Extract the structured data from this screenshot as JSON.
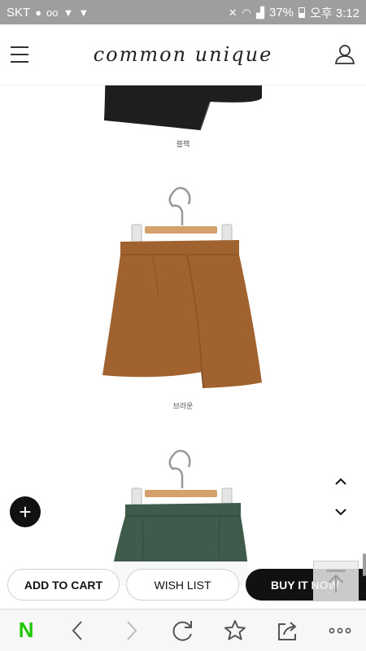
{
  "status_bar": {
    "carrier": "SKT",
    "battery": "37%",
    "time": "오후 3:12"
  },
  "header": {
    "logo": "common unique",
    "menu_icon": "hamburger-menu-icon",
    "account_icon": "user-icon"
  },
  "products": [
    {
      "caption": "블랙",
      "color": "#1e1e1e"
    },
    {
      "caption": "브라운",
      "color": "#a0622f"
    },
    {
      "caption": "",
      "color": "#3f5b4b"
    }
  ],
  "floating": {
    "add_icon": "plus-icon",
    "scroll_up_icon": "chevron-up-icon",
    "scroll_down_icon": "chevron-down-icon"
  },
  "actions": {
    "add_to_cart": "ADD TO CART",
    "wish_list": "WISH LIST",
    "buy_it_now": "BUY IT NOW",
    "top_icon": "arrow-up-to-top-icon"
  },
  "browser_nav": {
    "home": "N",
    "icons": [
      "back-icon",
      "forward-icon",
      "refresh-icon",
      "star-icon",
      "share-icon",
      "more-icon"
    ]
  }
}
